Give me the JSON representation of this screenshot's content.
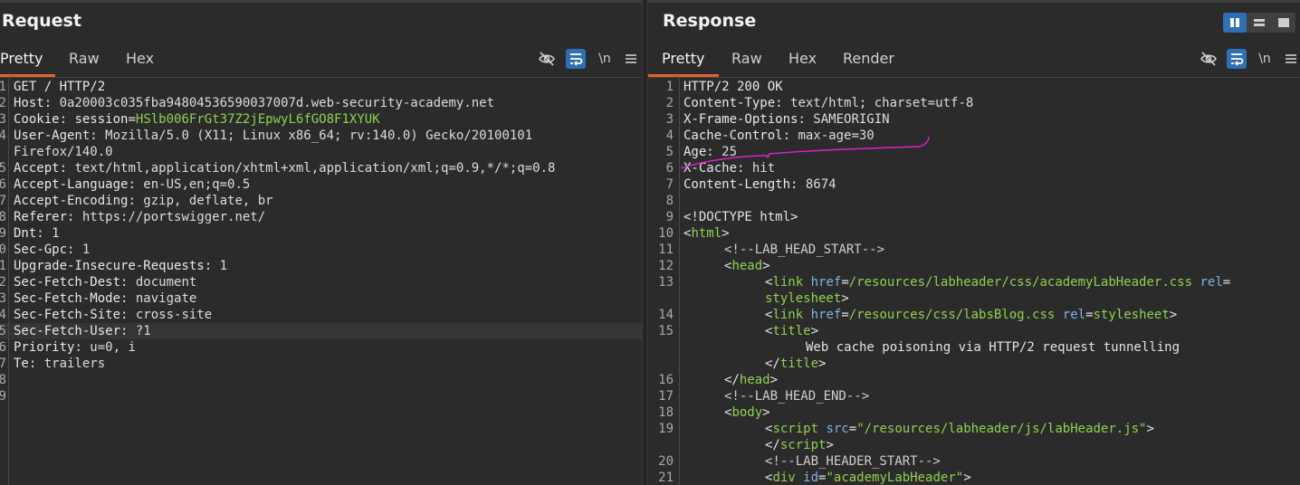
{
  "request": {
    "title": "Request",
    "tabs": [
      {
        "label": "Pretty",
        "active": true
      },
      {
        "label": "Raw",
        "active": false
      },
      {
        "label": "Hex",
        "active": false
      }
    ],
    "toolbar": {
      "newline_label": "\\n"
    },
    "lines": [
      {
        "n": "1",
        "h": "GET / HTTP/2",
        "v": ""
      },
      {
        "n": "2",
        "h": "Host",
        "v": "0a20003c035fba94804536590037007d.web-security-academy.net"
      },
      {
        "n": "3",
        "h": "Cookie",
        "ck": "session",
        "cv": "HSlb006FrGt37Z2jEpwyL6fGO8F1XYUK"
      },
      {
        "n": "4",
        "h": "User-Agent",
        "v": "Mozilla/5.0 (X11; Linux x86_64; rv:140.0) Gecko/20100101"
      },
      {
        "n": "",
        "h": "",
        "v": "Firefox/140.0"
      },
      {
        "n": "5",
        "h": "Accept",
        "v": "text/html,application/xhtml+xml,application/xml;q=0.9,*/*;q=0.8"
      },
      {
        "n": "6",
        "h": "Accept-Language",
        "v": "en-US,en;q=0.5"
      },
      {
        "n": "7",
        "h": "Accept-Encoding",
        "v": "gzip, deflate, br"
      },
      {
        "n": "8",
        "h": "Referer",
        "v": "https://portswigger.net/"
      },
      {
        "n": "9",
        "h": "Dnt",
        "v": "1"
      },
      {
        "n": "0",
        "h": "Sec-Gpc",
        "v": "1"
      },
      {
        "n": "1",
        "h": "Upgrade-Insecure-Requests",
        "v": "1"
      },
      {
        "n": "2",
        "h": "Sec-Fetch-Dest",
        "v": "document"
      },
      {
        "n": "3",
        "h": "Sec-Fetch-Mode",
        "v": "navigate"
      },
      {
        "n": "4",
        "h": "Sec-Fetch-Site",
        "v": "cross-site"
      },
      {
        "n": "5",
        "h": "Sec-Fetch-User",
        "v": "?1"
      },
      {
        "n": "6",
        "h": "Priority",
        "v": "u=0, i"
      },
      {
        "n": "7",
        "h": "Te",
        "v": "trailers"
      },
      {
        "n": "8",
        "h": "",
        "v": ""
      },
      {
        "n": "9",
        "h": "",
        "v": ""
      }
    ]
  },
  "response": {
    "title": "Response",
    "tabs": [
      {
        "label": "Pretty",
        "active": true
      },
      {
        "label": "Raw",
        "active": false
      },
      {
        "label": "Hex",
        "active": false
      },
      {
        "label": "Render",
        "active": false
      }
    ],
    "toolbar": {
      "newline_label": "\\n"
    },
    "lines": [
      {
        "n": "1",
        "t": "status",
        "text": "HTTP/2 200 OK"
      },
      {
        "n": "2",
        "t": "hdr",
        "h": "Content-Type",
        "v": "text/html; charset=utf-8"
      },
      {
        "n": "3",
        "t": "hdr",
        "h": "X-Frame-Options",
        "v": "SAMEORIGIN"
      },
      {
        "n": "4",
        "t": "hdr",
        "h": "Cache-Control",
        "v": "max-age=30"
      },
      {
        "n": "5",
        "t": "hdr",
        "h": "Age",
        "v": "25"
      },
      {
        "n": "6",
        "t": "hdr",
        "h": "X-Cache",
        "v": "hit"
      },
      {
        "n": "7",
        "t": "hdr",
        "h": "Content-Length",
        "v": "8674"
      },
      {
        "n": "8",
        "t": "blank"
      },
      {
        "n": "9",
        "t": "plain",
        "text": "<!DOCTYPE html>"
      },
      {
        "n": "10",
        "t": "tag",
        "ind": 0,
        "pre": "<",
        "name": "html",
        "post": ">"
      },
      {
        "n": "11",
        "t": "comment",
        "ind": 1,
        "text": "<!--LAB_HEAD_START-->"
      },
      {
        "n": "12",
        "t": "tag",
        "ind": 1,
        "pre": "<",
        "name": "head",
        "post": ">"
      },
      {
        "n": "13",
        "t": "link",
        "ind": 2,
        "name": "link",
        "attr1": "href",
        "val1": "/resources/labheader/css/academyLabHeader.css",
        "attr2": "rel",
        "val2": ""
      },
      {
        "n": "",
        "t": "cont",
        "ind": 2,
        "val": "stylesheet",
        "post": ">"
      },
      {
        "n": "14",
        "t": "link",
        "ind": 2,
        "name": "link",
        "attr1": "href",
        "val1": "/resources/css/labsBlog.css",
        "attr2": "rel",
        "val2": "stylesheet",
        "post": ">"
      },
      {
        "n": "15",
        "t": "tag",
        "ind": 2,
        "pre": "<",
        "name": "title",
        "post": ">"
      },
      {
        "n": "",
        "t": "plain",
        "ind": 3,
        "text": "Web cache poisoning via HTTP/2 request tunnelling"
      },
      {
        "n": "",
        "t": "tag",
        "ind": 2,
        "pre": "</",
        "name": "title",
        "post": ">"
      },
      {
        "n": "16",
        "t": "tag",
        "ind": 1,
        "pre": "</",
        "name": "head",
        "post": ">"
      },
      {
        "n": "17",
        "t": "comment",
        "ind": 1,
        "text": "<!--LAB_HEAD_END-->"
      },
      {
        "n": "18",
        "t": "tag",
        "ind": 1,
        "pre": "<",
        "name": "body",
        "post": ">"
      },
      {
        "n": "19",
        "t": "script",
        "ind": 2,
        "name": "script",
        "attr1": "src",
        "val1": "\"/resources/labheader/js/labHeader.js\"",
        "post": ">"
      },
      {
        "n": "",
        "t": "tag",
        "ind": 2,
        "pre": "</",
        "name": "script",
        "post": ">"
      },
      {
        "n": "20",
        "t": "comment",
        "ind": 2,
        "text": "<!--LAB_HEADER_START-->"
      },
      {
        "n": "21",
        "t": "script",
        "ind": 2,
        "name": "div",
        "attr1": "id",
        "val1": "\"academyLabHeader\"",
        "post": ">"
      }
    ]
  },
  "colors": {
    "accent": "#e4622a",
    "selected": "#2f6fb3",
    "annotation": "#e020c8",
    "string": "#8fd14f",
    "attr": "#7fb2e8"
  }
}
